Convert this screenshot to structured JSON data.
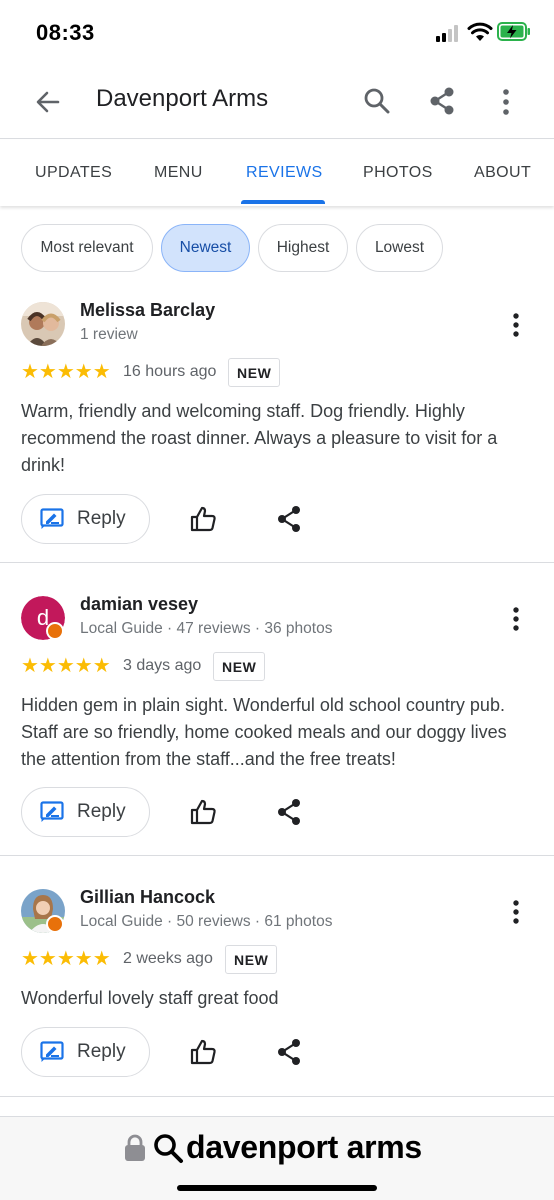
{
  "status_bar": {
    "time": "08:33"
  },
  "app_bar": {
    "title": "Davenport Arms"
  },
  "tabs": [
    {
      "label": "UPDATES"
    },
    {
      "label": "MENU"
    },
    {
      "label": "REVIEWS"
    },
    {
      "label": "PHOTOS"
    },
    {
      "label": "ABOUT"
    }
  ],
  "active_tab": "REVIEWS",
  "filters": [
    {
      "label": "Most relevant"
    },
    {
      "label": "Newest"
    },
    {
      "label": "Highest"
    },
    {
      "label": "Lowest"
    }
  ],
  "selected_filter": "Newest",
  "reviews": [
    {
      "name": "Melissa Barclay",
      "meta": "1 review",
      "stars": "★★★★★",
      "rating": 5,
      "time": "16 hours ago",
      "badge": "NEW",
      "text": "Warm, friendly and welcoming staff. Dog friendly. Highly recommend the roast dinner. Always a pleasure to visit for a drink!",
      "reply_label": "Reply"
    },
    {
      "name": "damian vesey",
      "avatar_letter": "d",
      "meta": "Local Guide · 47 reviews · 36 photos",
      "stars": "★★★★★",
      "rating": 5,
      "time": "3 days ago",
      "badge": "NEW",
      "text": "Hidden gem in plain sight. Wonderful old school country pub. Staff are so friendly, home cooked meals and our doggy lives the attention from the staff...and the free treats!",
      "reply_label": "Reply"
    },
    {
      "name": "Gillian Hancock",
      "meta": "Local Guide · 50 reviews · 61 photos",
      "stars": "★★★★★",
      "rating": 5,
      "time": "2 weeks ago",
      "badge": "NEW",
      "text": "Wonderful lovely staff great food",
      "reply_label": "Reply"
    }
  ],
  "url_bar": {
    "text": "davenport arms"
  },
  "colors": {
    "accent": "#1a73e8",
    "star": "#fbbc04",
    "chip_selected_bg": "#d2e3fc",
    "avatar_d": "#c2185b",
    "local_guide_badge": "#e8710a"
  }
}
